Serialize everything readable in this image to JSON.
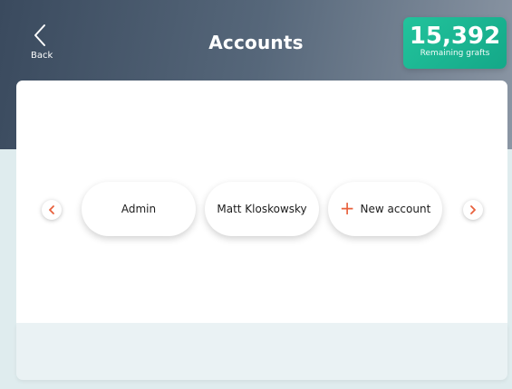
{
  "header": {
    "back_label": "Back",
    "title": "Accounts"
  },
  "grafts": {
    "count": "15,392",
    "label": "Remaining grafts"
  },
  "accounts": [
    {
      "label": "Admin"
    },
    {
      "label": "Matt Kloskowsky"
    }
  ],
  "new_account": {
    "label": "New account",
    "icon": "plus-icon"
  },
  "carousel": {
    "prev_icon": "chevron-left-icon",
    "next_icon": "chevron-right-icon"
  },
  "colors": {
    "accent": "#e8603c",
    "badge": "#1db894",
    "header": "#4a5a6e"
  }
}
